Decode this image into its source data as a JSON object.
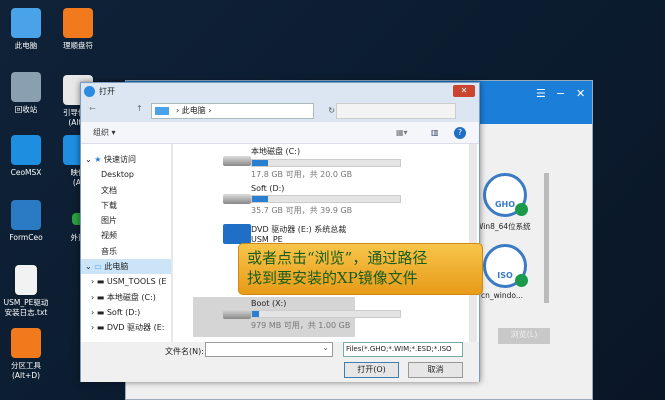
{
  "desktop": {
    "icons": [
      {
        "label": "此电脑",
        "color": "#4aa3e8"
      },
      {
        "label": "回收站",
        "color": "#8aa0b0"
      },
      {
        "label": "CeoMSX",
        "color": "#1e8ee0"
      },
      {
        "label": "FormCeo",
        "color": "#2a7ac4"
      },
      {
        "label": "USM_PE驱动\n安装日志.txt",
        "color": "#f2f2f2"
      },
      {
        "label": "分区工具\n(Alt+D)",
        "color": "#f07a1c"
      }
    ],
    "icons2": [
      {
        "label": "理顺盘符",
        "color": "#f07a1c"
      },
      {
        "label": "引导修复\n(Alt+",
        "color": "#e8e8e8"
      },
      {
        "label": "映像\n(Al",
        "color": "#1e8ee0"
      },
      {
        "label": "外置",
        "color": "#2aa040"
      }
    ]
  },
  "app": {
    "images": [
      {
        "type": "GHO",
        "label": "Win8_64位系统"
      },
      {
        "type": "ISO",
        "label": "cn_windo..."
      }
    ],
    "browse": "浏览(L)"
  },
  "dialog": {
    "title": "打开",
    "address": "此电脑",
    "organize": "组织 ▾",
    "nav": [
      "快速访问",
      "Desktop",
      "文档",
      "下载",
      "图片",
      "视频",
      "音乐",
      "此电脑",
      "USM_TOOLS (E",
      "本地磁盘 (C:)",
      "Soft (D:)",
      "DVD 驱动器 (E:"
    ],
    "drives": [
      {
        "name": "本地磁盘 (C:)",
        "info": "17.8 GB 可用，共 20.0 GB",
        "used": 11
      },
      {
        "name": "Soft (D:)",
        "info": "35.7 GB 可用，共 39.9 GB",
        "used": 11
      },
      {
        "name": "DVD 驱动器 (E:) 系统总裁",
        "sub": "USM_PE"
      },
      {
        "name": "Boot (X:)",
        "info": "979 MB 可用，共 1.00 GB",
        "used": 5
      }
    ],
    "filename_label": "文件名(N):",
    "filename": "",
    "filter": "Files(*.GHO;*.WIM;*.ESD;*.ISO",
    "open": "打开(O)",
    "cancel": "取消"
  },
  "tooltip": {
    "line1": "或者点击“浏览”，通过路径",
    "line2": "找到要安装的XP镜像文件"
  }
}
